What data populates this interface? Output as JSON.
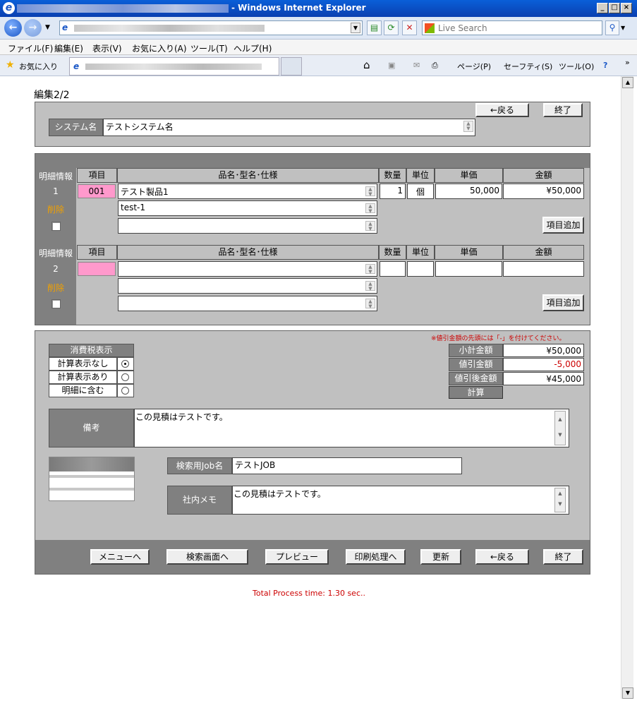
{
  "window": {
    "title": "- Windows Internet Explorer"
  },
  "toolbar": {
    "search_placeholder": "Live Search"
  },
  "menu": [
    "ファイル(F)",
    "編集(E)",
    "表示(V)",
    "お気に入り(A)",
    "ツール(T)",
    "ヘルプ(H)"
  ],
  "favorites": {
    "label": "お気に入り",
    "page": "ページ(P)",
    "safety": "セーフティ(S)",
    "tools": "ツール(O)"
  },
  "page": {
    "heading": "編集2/2",
    "back_label": "←戻る",
    "exit_label": "終了",
    "system_label": "システム名",
    "system_value": "テストシステム名",
    "columns": {
      "item": "項目",
      "name": "品名･型名･仕様",
      "qty": "数量",
      "unit": "単位",
      "price": "単価",
      "amount": "金額"
    },
    "detail_label": "明細情報",
    "delete_label": "削除",
    "add_item_label": "項目追加",
    "rows": [
      {
        "no": "1",
        "code": "001",
        "name1": "テスト製品1",
        "name2": "test-1",
        "name3": "",
        "qty": "1",
        "unit": "個",
        "price": "50,000",
        "amount": "¥50,000"
      },
      {
        "no": "2",
        "code": "",
        "name1": "",
        "name2": "",
        "name3": "",
        "qty": "",
        "unit": "",
        "price": "",
        "amount": ""
      }
    ],
    "discount_note": "※値引金額の先頭には「-」を付けてください。",
    "tax": {
      "title": "消費税表示",
      "options": [
        "計算表示なし",
        "計算表示あり",
        "明細に含む"
      ],
      "selected": "計算表示なし"
    },
    "totals": {
      "subtotal_label": "小計金額",
      "subtotal": "¥50,000",
      "discount_label": "値引金額",
      "discount": "-5,000",
      "after_label": "値引後金額",
      "after": "¥45,000",
      "calc_label": "計算"
    },
    "remarks_label": "備考",
    "remarks_value": "この見積はテストです。",
    "job_label": "検索用Job名",
    "job_value": "テストJOB",
    "memo_label": "社内メモ",
    "memo_value": "この見積はテストです。",
    "footer_buttons": [
      "メニューへ",
      "検索画面へ",
      "プレビュー",
      "印刷処理へ",
      "更新",
      "←戻る",
      "終了"
    ],
    "process_time": "Total Process time: 1.30 sec.."
  },
  "colors": {
    "code_bg": "#ff99cc",
    "panel": "#c0c0c0",
    "dark": "#808080",
    "note": "#cc0000",
    "orange": "#f0a000"
  }
}
